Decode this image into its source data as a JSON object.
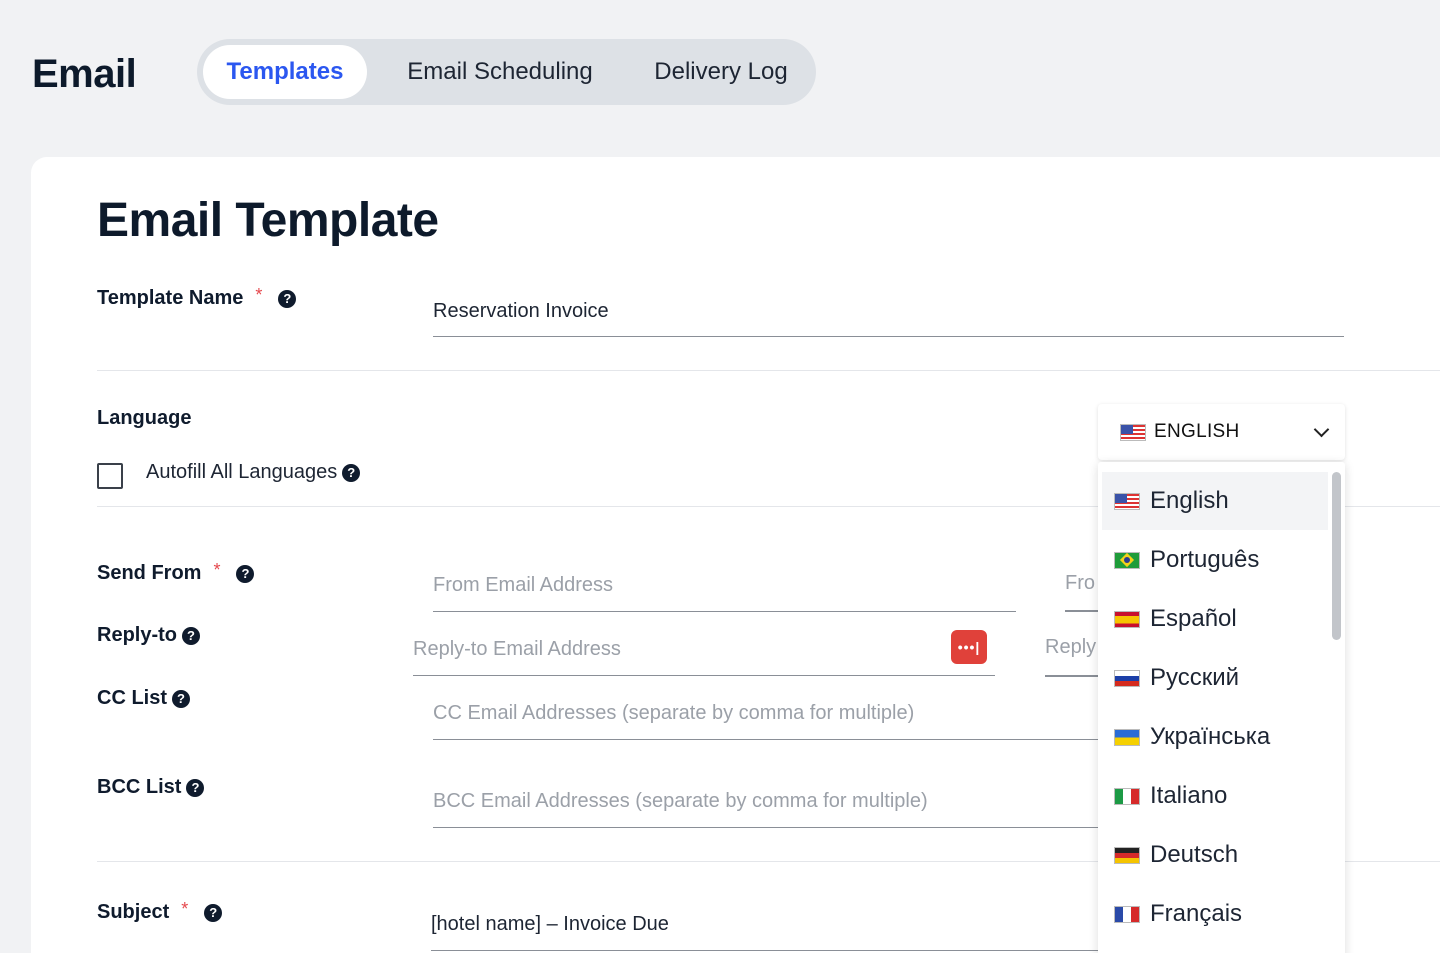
{
  "header": {
    "title": "Email"
  },
  "tabs": [
    {
      "label": "Templates",
      "active": true
    },
    {
      "label": "Email Scheduling",
      "active": false
    },
    {
      "label": "Delivery Log",
      "active": false
    }
  ],
  "form": {
    "title": "Email Template",
    "template_name": {
      "label": "Template Name",
      "required_mark": "*",
      "value": "Reservation Invoice"
    },
    "language": {
      "label": "Language",
      "autofill_label": "Autofill All Languages",
      "autofill_checked": false,
      "selected": "ENGLISH",
      "options": [
        {
          "label": "English",
          "flag": "us-flag-icon"
        },
        {
          "label": "Português",
          "flag": "br-flag-icon"
        },
        {
          "label": "Español",
          "flag": "es-flag-icon"
        },
        {
          "label": "Русский",
          "flag": "ru-flag-icon"
        },
        {
          "label": "Українська",
          "flag": "ua-flag-icon"
        },
        {
          "label": "Italiano",
          "flag": "it-flag-icon"
        },
        {
          "label": "Deutsch",
          "flag": "de-flag-icon"
        },
        {
          "label": "Français",
          "flag": "fr-flag-icon"
        }
      ]
    },
    "send_from": {
      "label": "Send From",
      "required_mark": "*",
      "placeholder": "From Email Address",
      "second_placeholder_visible": "Fro"
    },
    "reply_to": {
      "label": "Reply-to",
      "placeholder": "Reply-to Email Address",
      "second_placeholder_visible": "Reply",
      "action_icon": "dots-icon",
      "action_text": "•••|"
    },
    "cc": {
      "label": "CC List",
      "placeholder": "CC Email Addresses (separate by comma for multiple)"
    },
    "bcc": {
      "label": "BCC List",
      "placeholder": "BCC Email Addresses (separate by comma for multiple)"
    },
    "subject": {
      "label": "Subject",
      "required_mark": "*",
      "value": "[hotel name] – Invoice Due"
    },
    "help_glyph": "?"
  },
  "colors": {
    "accent": "#2b57f0",
    "required": "#e5484d",
    "action_button": "#e0413a"
  }
}
